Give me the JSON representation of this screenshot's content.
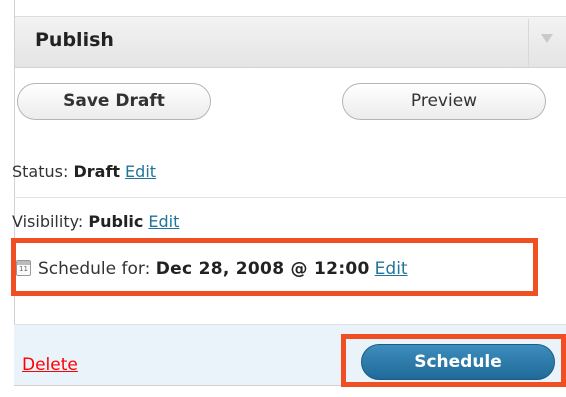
{
  "panel": {
    "title": "Publish"
  },
  "buttons": {
    "save_draft": "Save Draft",
    "preview": "Preview",
    "schedule": "Schedule",
    "delete": "Delete"
  },
  "status": {
    "label": "Status:",
    "value": "Draft",
    "edit": "Edit"
  },
  "visibility": {
    "label": "Visibility:",
    "value": "Public",
    "edit": "Edit"
  },
  "schedule": {
    "label": "Schedule for:",
    "value": "Dec 28, 2008 @ 12:00",
    "edit": "Edit",
    "calendar_day": "11"
  },
  "colors": {
    "link": "#21759b",
    "delete": "#ff0000",
    "primary_button": "#2a7aaa",
    "highlight": "#f04e23",
    "footer_bg": "#eaf2fa"
  },
  "icons": {
    "toggle": "triangle-down-icon",
    "calendar": "calendar-icon"
  }
}
